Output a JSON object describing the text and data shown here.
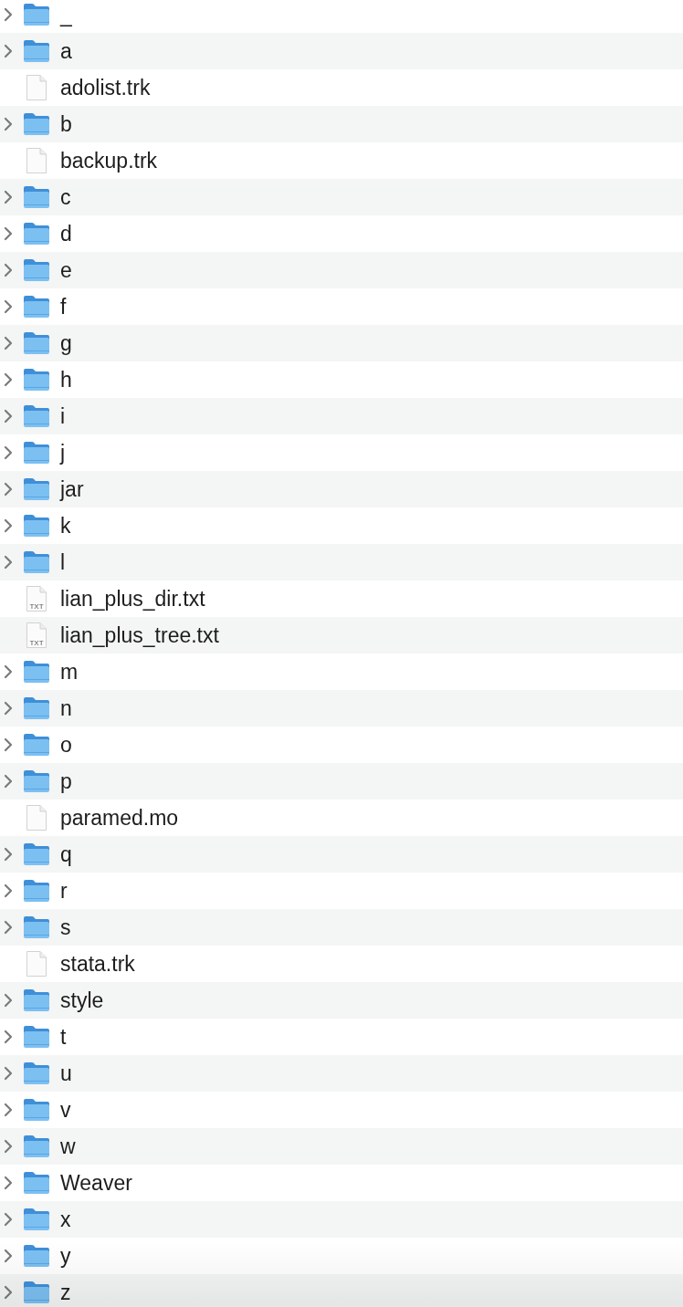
{
  "items": [
    {
      "kind": "folder",
      "name": "_",
      "expanded": false
    },
    {
      "kind": "folder",
      "name": "a",
      "expanded": false
    },
    {
      "kind": "file",
      "name": "adolist.trk"
    },
    {
      "kind": "folder",
      "name": "b",
      "expanded": false
    },
    {
      "kind": "file",
      "name": "backup.trk"
    },
    {
      "kind": "folder",
      "name": "c",
      "expanded": false
    },
    {
      "kind": "folder",
      "name": "d",
      "expanded": false
    },
    {
      "kind": "folder",
      "name": "e",
      "expanded": false
    },
    {
      "kind": "folder",
      "name": "f",
      "expanded": false
    },
    {
      "kind": "folder",
      "name": "g",
      "expanded": false
    },
    {
      "kind": "folder",
      "name": "h",
      "expanded": false
    },
    {
      "kind": "folder",
      "name": "i",
      "expanded": false
    },
    {
      "kind": "folder",
      "name": "j",
      "expanded": false
    },
    {
      "kind": "folder",
      "name": "jar",
      "expanded": false
    },
    {
      "kind": "folder",
      "name": "k",
      "expanded": false
    },
    {
      "kind": "folder",
      "name": "l",
      "expanded": false
    },
    {
      "kind": "text-file",
      "name": "lian_plus_dir.txt",
      "badge": "TXT"
    },
    {
      "kind": "text-file",
      "name": "lian_plus_tree.txt",
      "badge": "TXT"
    },
    {
      "kind": "folder",
      "name": "m",
      "expanded": false
    },
    {
      "kind": "folder",
      "name": "n",
      "expanded": false
    },
    {
      "kind": "folder",
      "name": "o",
      "expanded": false
    },
    {
      "kind": "folder",
      "name": "p",
      "expanded": false
    },
    {
      "kind": "file",
      "name": "paramed.mo"
    },
    {
      "kind": "folder",
      "name": "q",
      "expanded": false
    },
    {
      "kind": "folder",
      "name": "r",
      "expanded": false
    },
    {
      "kind": "folder",
      "name": "s",
      "expanded": false
    },
    {
      "kind": "file",
      "name": "stata.trk"
    },
    {
      "kind": "folder",
      "name": "style",
      "expanded": false
    },
    {
      "kind": "folder",
      "name": "t",
      "expanded": false
    },
    {
      "kind": "folder",
      "name": "u",
      "expanded": false
    },
    {
      "kind": "folder",
      "name": "v",
      "expanded": false
    },
    {
      "kind": "folder",
      "name": "w",
      "expanded": false
    },
    {
      "kind": "folder",
      "name": "Weaver",
      "expanded": false
    },
    {
      "kind": "folder",
      "name": "x",
      "expanded": false
    },
    {
      "kind": "folder",
      "name": "y",
      "expanded": false
    },
    {
      "kind": "folder",
      "name": "z",
      "expanded": false
    }
  ]
}
